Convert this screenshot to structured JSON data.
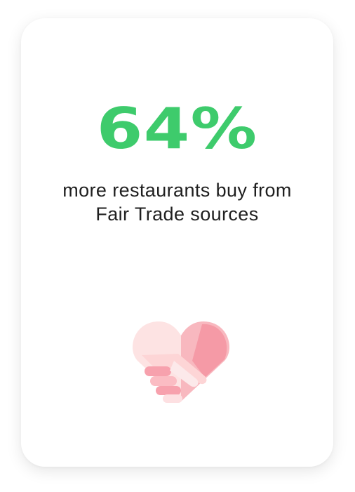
{
  "stat": {
    "value": "64%",
    "color": "#3ecb6c"
  },
  "caption": {
    "text": "more restaurants buy from Fair Trade sources"
  },
  "icon": {
    "name": "heart-handshake-icon",
    "colors": [
      "#fde3e3",
      "#fbc7c9",
      "#f7a4ae",
      "#f48a98"
    ]
  }
}
